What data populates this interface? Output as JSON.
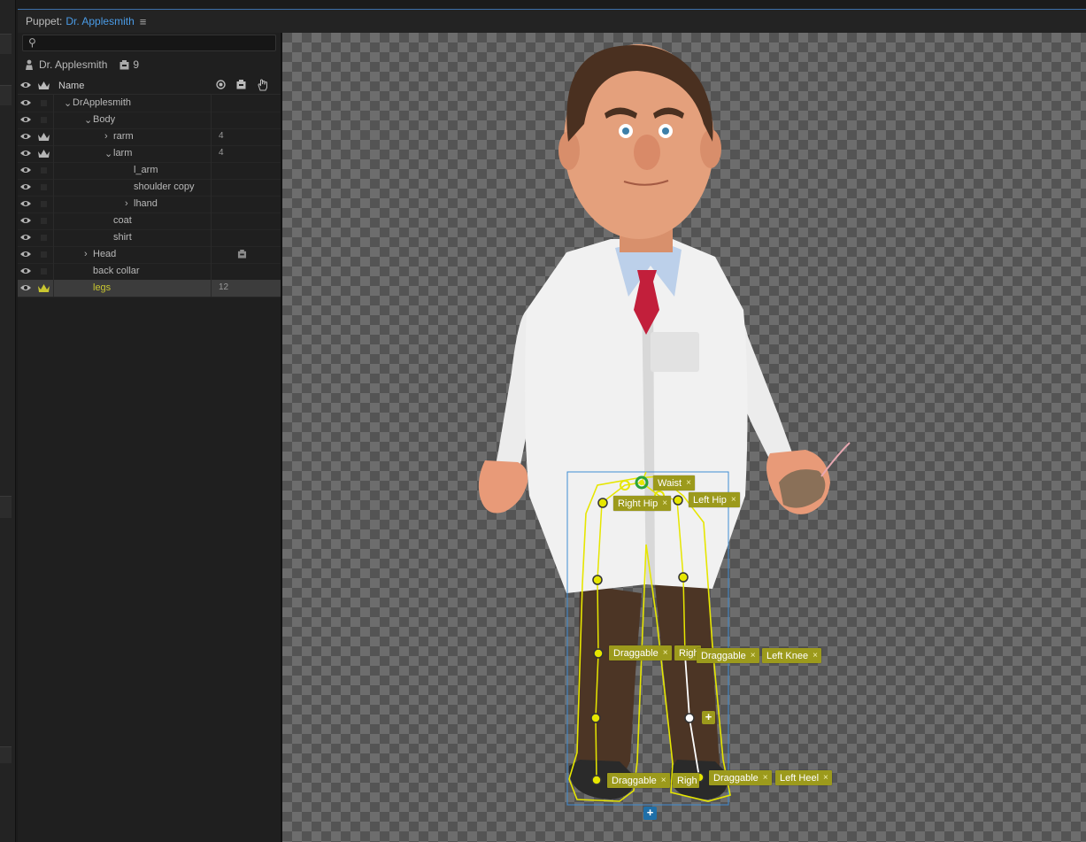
{
  "panel": {
    "title": "Puppet:",
    "puppet_name": "Dr. Applesmith",
    "menu_icon": "hamburger-icon"
  },
  "search": {
    "placeholder": "",
    "icon": "search-icon"
  },
  "puppet_info": {
    "name": "Dr. Applesmith",
    "tag_count": "9"
  },
  "columns": {
    "name": "Name"
  },
  "rows": [
    {
      "label": "DrApplesmith",
      "num": "",
      "crown": false,
      "expanded": true,
      "has_children": true
    },
    {
      "label": "Body",
      "num": "",
      "crown": false,
      "expanded": true,
      "has_children": true
    },
    {
      "label": "rarm",
      "num": "4",
      "crown": true,
      "expanded": false,
      "has_children": true
    },
    {
      "label": "larm",
      "num": "4",
      "crown": true,
      "expanded": true,
      "has_children": true
    },
    {
      "label": "l_arm",
      "num": "",
      "crown": false,
      "expanded": false,
      "has_children": false
    },
    {
      "label": "shoulder copy",
      "num": "",
      "crown": false,
      "expanded": false,
      "has_children": false
    },
    {
      "label": "lhand",
      "num": "",
      "crown": false,
      "expanded": false,
      "has_children": true
    },
    {
      "label": "coat",
      "num": "",
      "crown": false,
      "expanded": false,
      "has_children": false
    },
    {
      "label": "shirt",
      "num": "",
      "crown": false,
      "expanded": false,
      "has_children": false
    },
    {
      "label": "Head",
      "num": "",
      "crown": false,
      "expanded": false,
      "has_children": true,
      "tagged": true
    },
    {
      "label": "back collar",
      "num": "",
      "crown": false,
      "expanded": false,
      "has_children": false
    },
    {
      "label": "legs",
      "num": "12",
      "crown": true,
      "expanded": false,
      "has_children": false,
      "selected": true
    }
  ],
  "handles": {
    "waist": "Waist",
    "right_hip": "Right Hip",
    "left_hip": "Left Hip",
    "draggable_1": "Draggable",
    "partial_1": "Righ",
    "draggable_2": "Draggable",
    "left_knee": "Left Knee",
    "draggable_3": "Draggable",
    "partial_2": "Righ",
    "draggable_4": "Draggable",
    "left_heel": "Left Heel",
    "remove_glyph": "×",
    "add_glyph": "+"
  },
  "colors": {
    "accent_blue": "#4a9be6",
    "handle_yellow": "#e4e400",
    "tag_olive": "#9c9a1c",
    "selected_text": "#c9c630"
  }
}
